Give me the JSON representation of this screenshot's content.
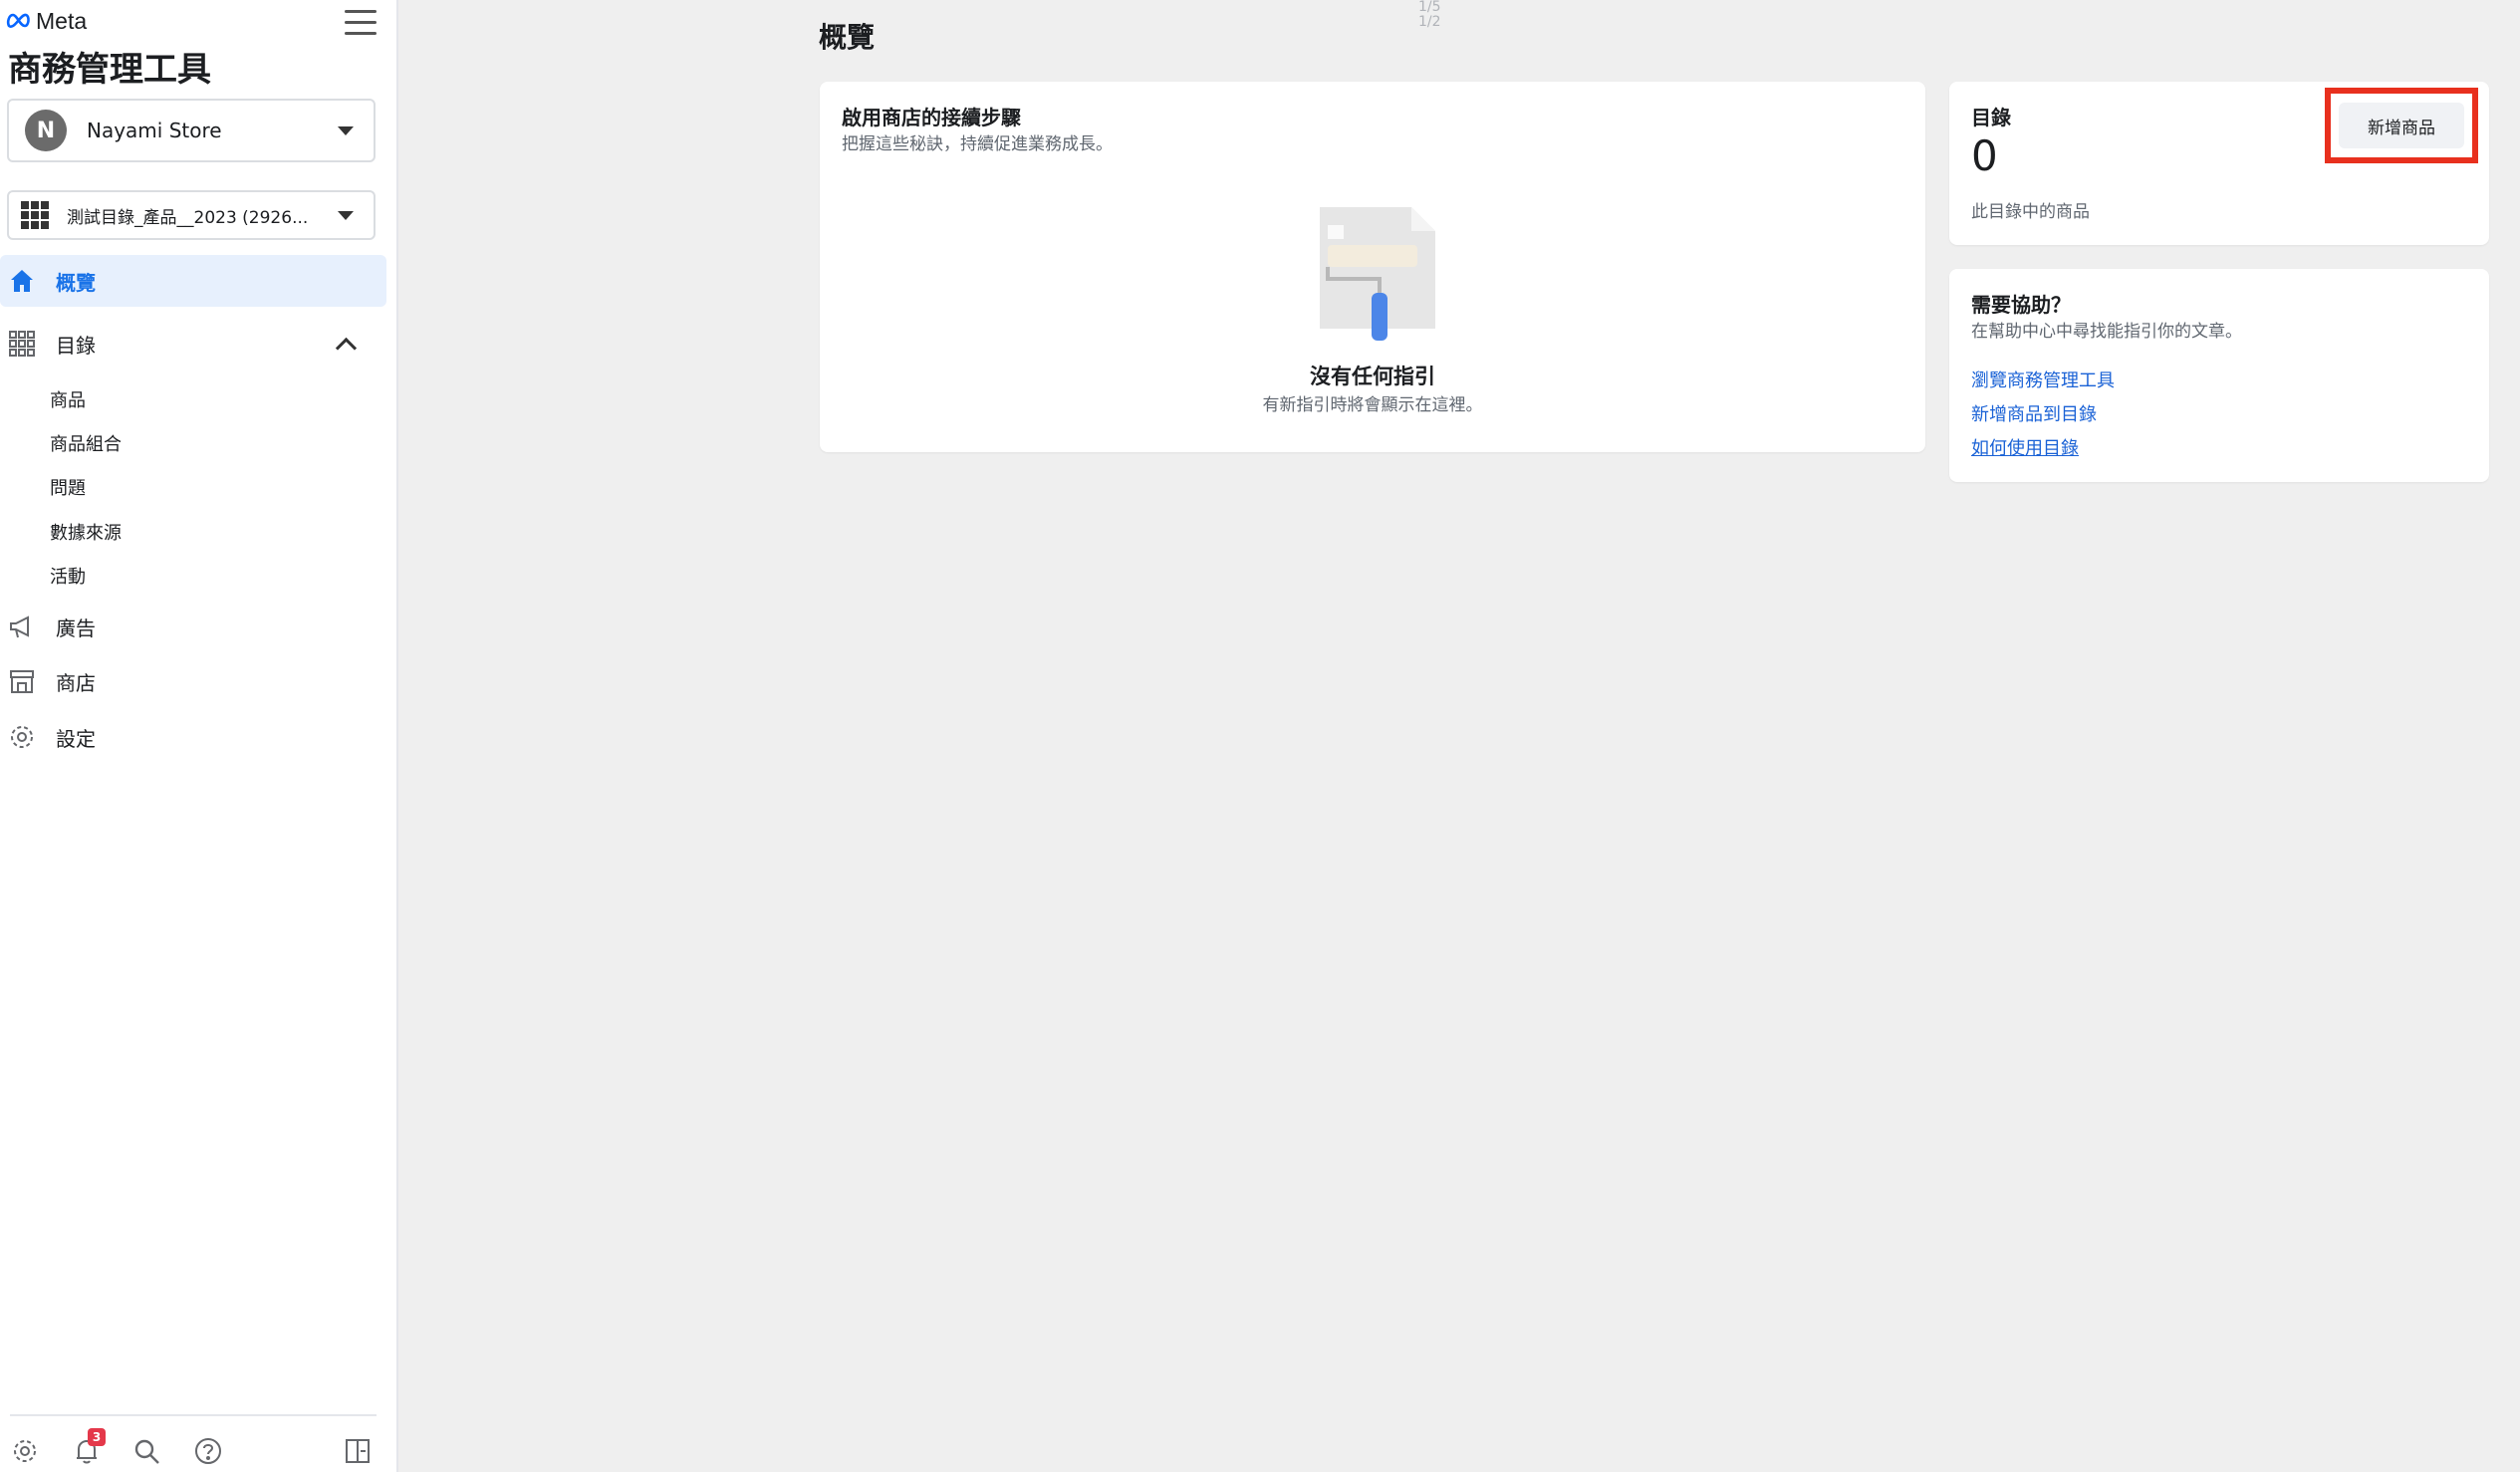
{
  "brand": {
    "wordmark": "Meta"
  },
  "app_title": "商務管理工具",
  "store_selector": {
    "avatar_initial": "N",
    "name": "Nayami Store"
  },
  "catalog_selector": {
    "name": "測試目錄_產品__2023 (2926..."
  },
  "nav": {
    "overview": "概覽",
    "catalog": "目錄",
    "catalog_sub": [
      "商品",
      "商品組合",
      "問題",
      "數據來源",
      "活動"
    ],
    "ads": "廣告",
    "shop": "商店",
    "settings": "設定"
  },
  "footer": {
    "notification_count": "3"
  },
  "page": {
    "title": "概覽",
    "pager": [
      "1/5",
      "1/2"
    ]
  },
  "steps_card": {
    "title": "啟用商店的接續步驟",
    "subtitle": "把握這些秘訣，持續促進業務成長。",
    "empty_title": "沒有任何指引",
    "empty_subtitle": "有新指引時將會顯示在這裡。"
  },
  "catalog_card": {
    "title": "目錄",
    "count": "0",
    "caption": "此目錄中的商品",
    "add_button": "新增商品"
  },
  "help_card": {
    "title": "需要協助？",
    "subtitle": "在幫助中心中尋找能指引你的文章。",
    "links": [
      "瀏覽商務管理工具",
      "新增商品到目錄",
      "如何使用目錄"
    ]
  },
  "colors": {
    "accent": "#1a73e8",
    "highlight_box": "#e8301e",
    "link": "#1a62d6"
  }
}
